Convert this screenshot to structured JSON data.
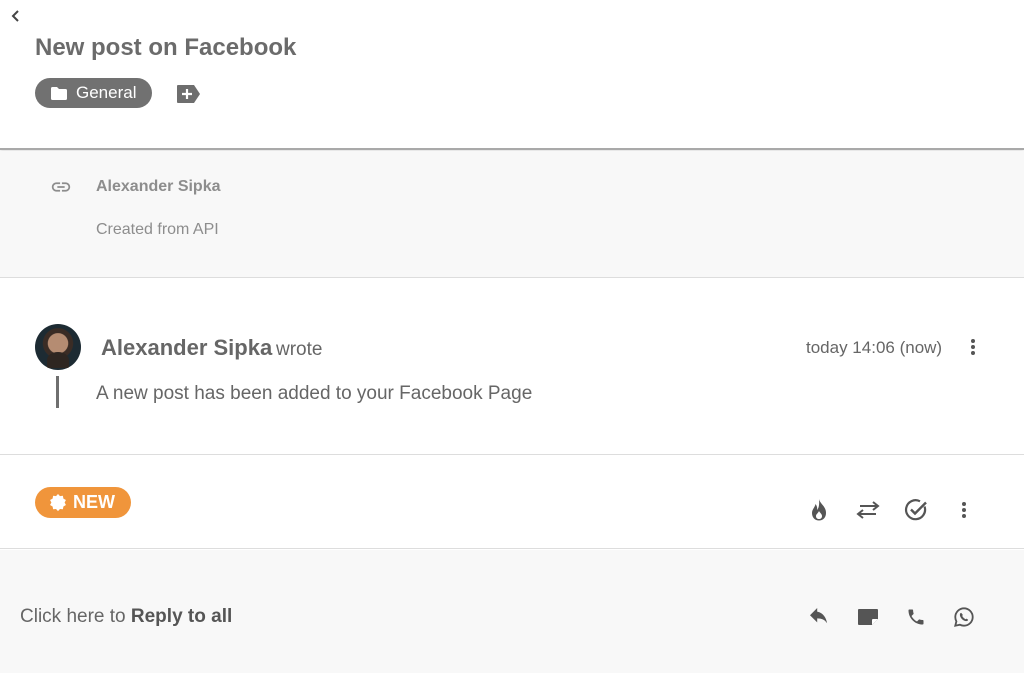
{
  "header": {
    "back_icon": "chevron-left-icon",
    "title": "New post on Facebook",
    "tag_label": "General",
    "tag_icon": "folder-icon",
    "add_tag_icon": "add-tag-icon"
  },
  "info": {
    "icon": "link-icon",
    "author": "Alexander Sipka",
    "subtitle": "Created from API"
  },
  "message": {
    "author": "Alexander Sipka",
    "verb": "wrote",
    "time": "today 14:06 (now)",
    "body": "A new post has been added to your Facebook Page",
    "more_icon": "more-vertical-icon"
  },
  "status": {
    "badge_label": "NEW",
    "badge_icon": "new-badge-icon",
    "badge_color": "#f0953b",
    "actions": [
      "priority-flame-icon",
      "transfer-icon",
      "resolve-check-icon",
      "more-vertical-icon"
    ]
  },
  "reply": {
    "prefix": "Click here to",
    "action": "Reply to all",
    "actions": [
      "reply-icon",
      "note-icon",
      "phone-icon",
      "whatsapp-icon"
    ]
  },
  "colors": {
    "text": "#666666",
    "muted": "#8d8d8d",
    "tag_bg": "#717171",
    "panel_bg": "#f8f8f8"
  }
}
